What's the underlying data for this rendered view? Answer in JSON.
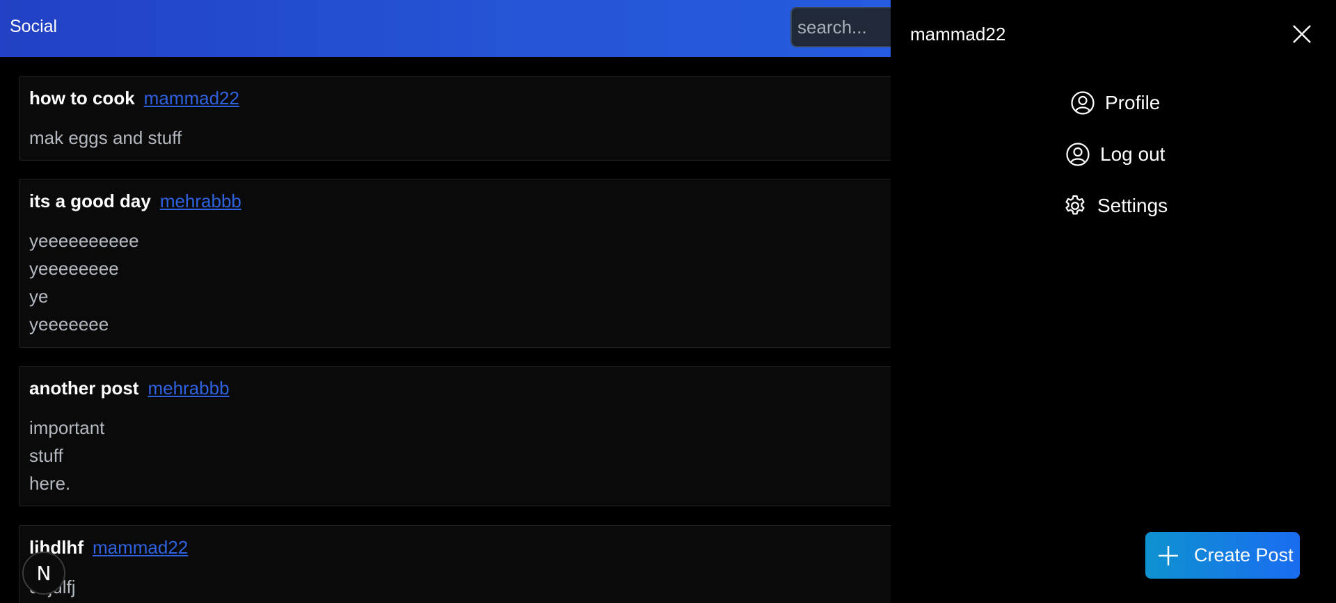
{
  "header": {
    "brand": "Social",
    "search_placeholder": "search..."
  },
  "posts": [
    {
      "title": "how to cook",
      "author": "mammad22",
      "body": [
        "mak eggs and stuff"
      ]
    },
    {
      "title": "its a good day",
      "author": "mehrabbb",
      "body": [
        "yeeeeeeeeee",
        "yeeeeeeee",
        "ye",
        "yeeeeeee"
      ]
    },
    {
      "title": "another post",
      "author": "mehrabbb",
      "body": [
        "important",
        "stuff",
        "here."
      ]
    },
    {
      "title": "lihdlhf",
      "author": "mammad22",
      "body": [
        "dlfjdlfj"
      ]
    }
  ],
  "drawer": {
    "username": "mammad22",
    "menu": [
      {
        "label": "Profile",
        "icon": "user-circle-icon"
      },
      {
        "label": "Log out",
        "icon": "user-circle-icon"
      },
      {
        "label": "Settings",
        "icon": "gear-icon"
      }
    ],
    "create_label": "Create Post"
  },
  "badge": {
    "letter": "N"
  },
  "colors": {
    "accent": "#2563eb",
    "link": "#2f62e0",
    "create_gradient_start": "#0e92d0",
    "create_gradient_end": "#1a6cf0"
  }
}
